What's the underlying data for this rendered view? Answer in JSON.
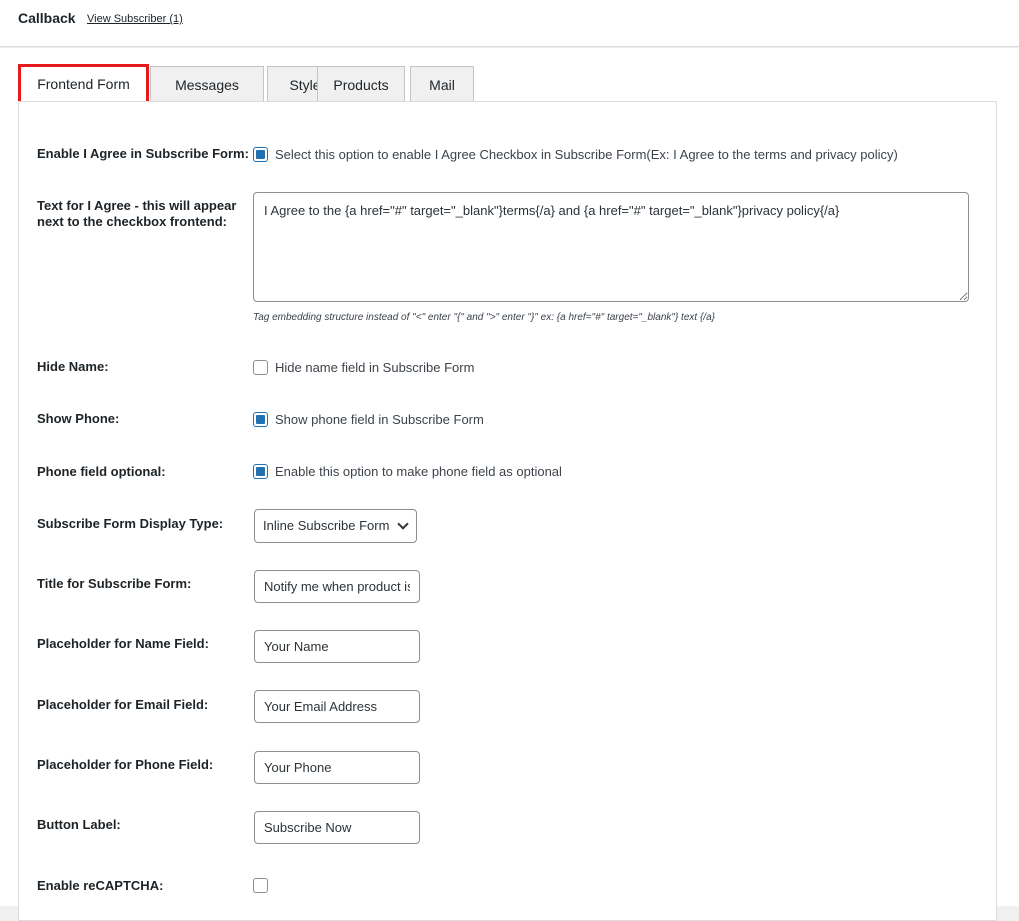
{
  "header": {
    "title": "Callback",
    "view_link": "View Subscriber (1)"
  },
  "tabs": [
    {
      "label": "Frontend Form",
      "active": true
    },
    {
      "label": "Messages",
      "active": false
    },
    {
      "label": "Style",
      "active": false
    },
    {
      "label": "Products",
      "active": false
    },
    {
      "label": "Mail",
      "active": false
    }
  ],
  "form": {
    "enable_agree": {
      "label": "Enable I Agree in Subscribe Form:",
      "checked": true,
      "text": "Select this option to enable I Agree Checkbox in Subscribe Form(Ex: I Agree to the terms and privacy policy)"
    },
    "agree_text": {
      "label": "Text for I Agree - this will appear next to the checkbox frontend:",
      "value": "I Agree to the {a href=\"#\" target=\"_blank\"}terms{/a} and {a href=\"#\" target=\"_blank\"}privacy policy{/a}",
      "hint": "Tag embedding structure instead of \"<\" enter \"{\" and \">\" enter \"}\" ex: {a href=\"#\" target=\"_blank\"} text {/a}"
    },
    "hide_name": {
      "label": "Hide Name:",
      "checked": false,
      "text": "Hide name field in Subscribe Form"
    },
    "show_phone": {
      "label": "Show Phone:",
      "checked": true,
      "text": "Show phone field in Subscribe Form"
    },
    "phone_optional": {
      "label": "Phone field optional:",
      "checked": true,
      "text": "Enable this option to make phone field as optional"
    },
    "display_type": {
      "label": "Subscribe Form Display Type:",
      "value": "Inline Subscribe Form"
    },
    "form_title": {
      "label": "Title for Subscribe Form:",
      "value": "Notify me when product is"
    },
    "name_placeholder": {
      "label": "Placeholder for Name Field:",
      "value": "Your Name"
    },
    "email_placeholder": {
      "label": "Placeholder for Email Field:",
      "value": "Your Email Address"
    },
    "phone_placeholder": {
      "label": "Placeholder for Phone Field:",
      "value": "Your Phone"
    },
    "button_label": {
      "label": "Button Label:",
      "value": "Subscribe Now"
    },
    "recaptcha": {
      "label": "Enable reCAPTCHA:",
      "checked": false
    }
  },
  "colors": {
    "accent": "#2271b1",
    "active_tab_border": "#e61a1a"
  }
}
